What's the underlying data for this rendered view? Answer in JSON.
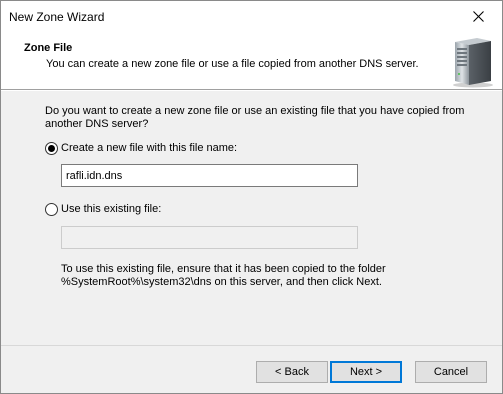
{
  "window": {
    "title": "New Zone Wizard"
  },
  "header": {
    "title": "Zone File",
    "subtitle": "You can create a new zone file or use a file copied from another DNS server."
  },
  "content": {
    "question": "Do you want to create a new zone file or use an existing file that you have copied from another DNS server?",
    "option_new": {
      "label": "Create a new file with this file name:",
      "selected": true,
      "value": "rafli.idn.dns"
    },
    "option_existing": {
      "label": "Use this existing file:",
      "selected": false,
      "value": ""
    },
    "note": "To use this existing file, ensure that it has been copied to the folder %SystemRoot%\\system32\\dns on this server, and then click Next."
  },
  "buttons": {
    "back": "< Back",
    "next": "Next >",
    "cancel": "Cancel"
  },
  "colors": {
    "default_button_border": "#0078d7",
    "dialog_bg": "#f0f0f0"
  }
}
